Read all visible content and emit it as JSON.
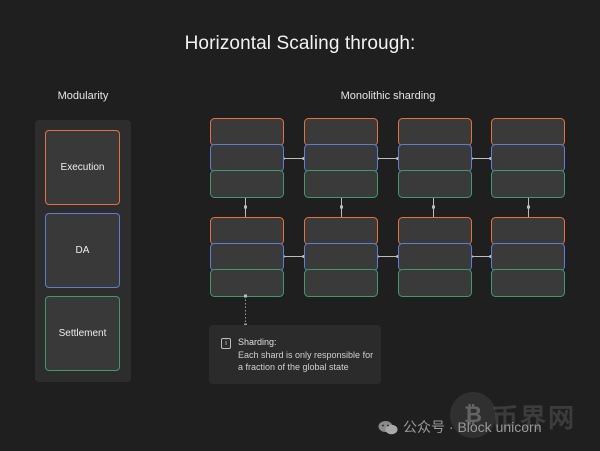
{
  "title": "Horizontal Scaling through:",
  "modularity": {
    "label": "Modularity",
    "layers": [
      {
        "label": "Execution",
        "color": "#e8703a"
      },
      {
        "label": "DA",
        "color": "#5b7fd6"
      },
      {
        "label": "Settlement",
        "color": "#3f9a6a"
      }
    ]
  },
  "sharding": {
    "label": "Monolithic sharding",
    "rows": 2,
    "columns": 4,
    "layer_colors": {
      "execution": "#e8703a",
      "da": "#5b7fd6",
      "settlement": "#3f9a6a"
    }
  },
  "note": {
    "icon": "info-icon",
    "heading": "Sharding:",
    "body": "Each shard is only responsible for a fraction of the global state"
  },
  "watermark": {
    "text": "公众号 · Block unicorn",
    "icon": "wechat-icon",
    "brand": "币界网"
  }
}
